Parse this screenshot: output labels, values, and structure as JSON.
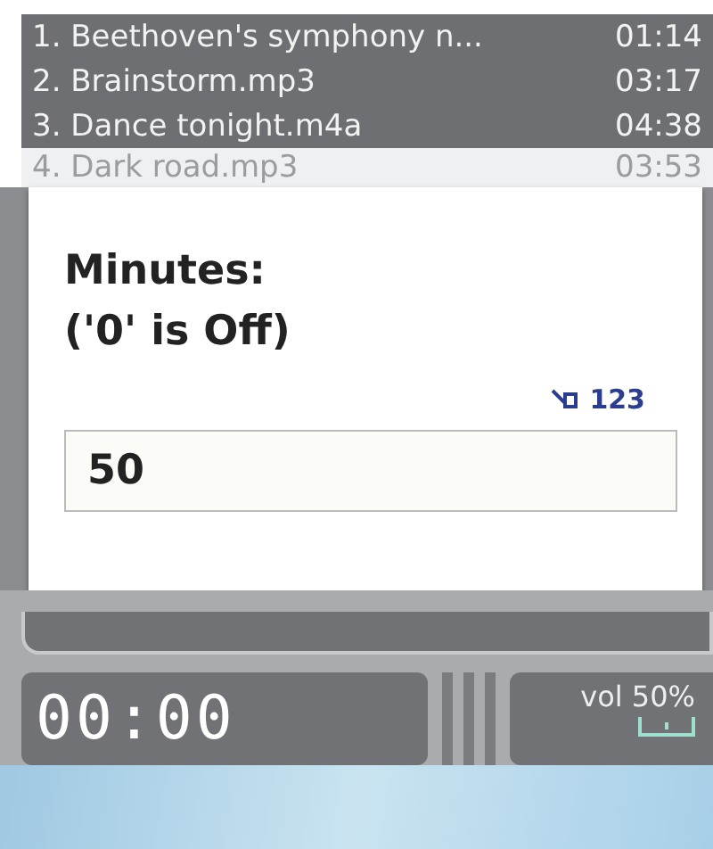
{
  "playlist": [
    {
      "title": "1. Beethoven's symphony n...",
      "duration": "01:14",
      "selected": false
    },
    {
      "title": "2. Brainstorm.mp3",
      "duration": "03:17",
      "selected": false
    },
    {
      "title": "3. Dance tonight.m4a",
      "duration": "04:38",
      "selected": false
    },
    {
      "title": "4. Dark road.mp3",
      "duration": "03:53",
      "selected": true
    }
  ],
  "dialog": {
    "prompt_lines": [
      "Minutes:",
      "('0' is Off)"
    ],
    "input_mode": "123",
    "value": "50"
  },
  "player": {
    "time": "00:00",
    "volume": "vol 50%"
  }
}
